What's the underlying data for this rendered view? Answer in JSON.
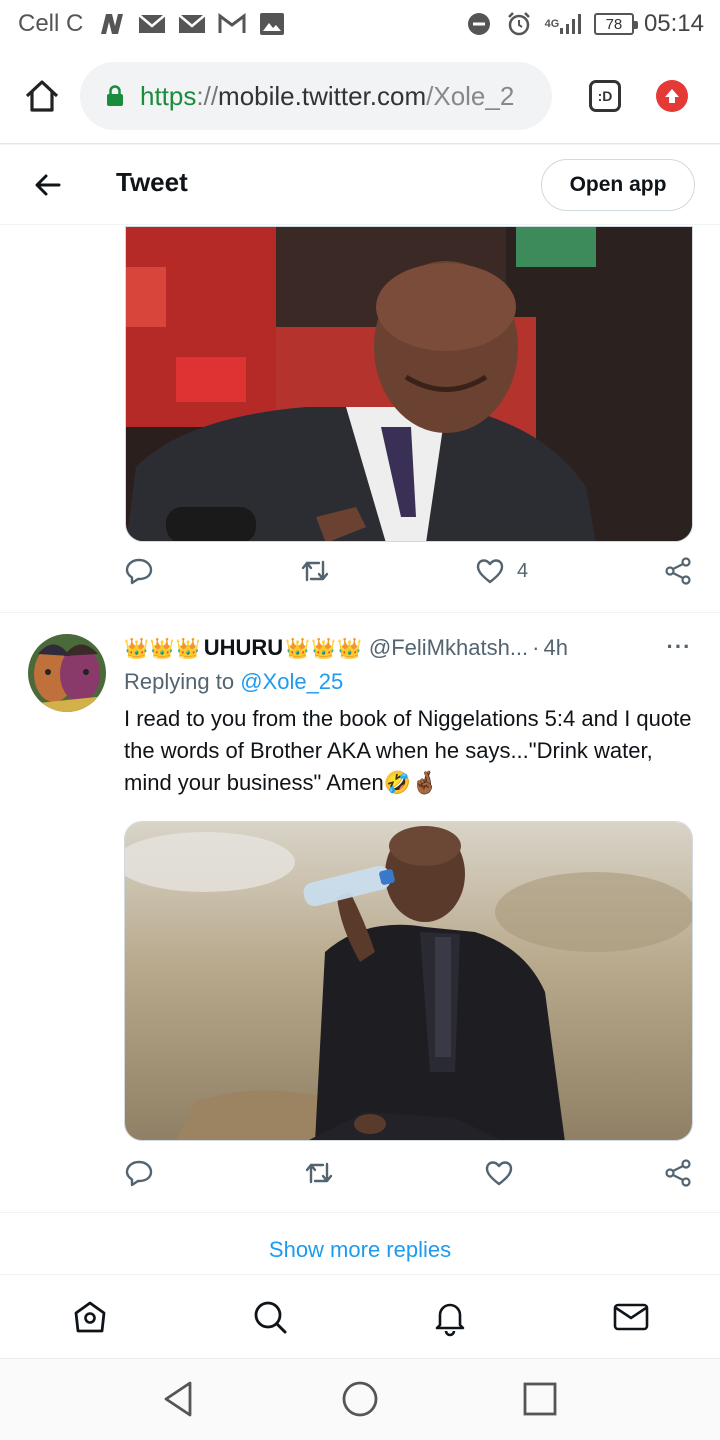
{
  "status_bar": {
    "carrier": "Cell C",
    "network": "4G",
    "battery": "78",
    "time": "05:14"
  },
  "browser": {
    "url_scheme": "https",
    "url_sep": "://",
    "url_host": "mobile.twitter.com",
    "url_path": "/Xole_2",
    "tab_label": ":D"
  },
  "header": {
    "title": "Tweet",
    "open_app": "Open app"
  },
  "first_tweet": {
    "like_count": "4"
  },
  "reply": {
    "crowns_before": "👑👑👑",
    "display_name": "UHURU",
    "crowns_after": "👑👑👑",
    "handle": "@FeliMkhatsh...",
    "dot": "·",
    "time": "4h",
    "more": "···",
    "replying_prefix": "Replying to",
    "replying_to": "@Xole_25",
    "text": "I read to you from the book of Niggelations 5:4 and I quote the words of Brother AKA when he says...\"Drink water, mind your business\" Amen🤣🤞🏾"
  },
  "show_more": "Show more replies",
  "colors": {
    "accent": "#1d9bf0",
    "secure_green": "#1a8c3c",
    "muted": "#536471",
    "update_red": "#e53935"
  },
  "icons": {
    "status": [
      "n-icon",
      "mail-icon",
      "mail-icon",
      "gmail-icon",
      "image-icon",
      "dnd-icon",
      "alarm-icon",
      "signal-icon",
      "battery-icon"
    ],
    "nav": [
      "home-icon",
      "search-icon",
      "notifications-icon",
      "messages-icon"
    ],
    "system": [
      "back-icon",
      "home-circle-icon",
      "recents-icon"
    ]
  }
}
